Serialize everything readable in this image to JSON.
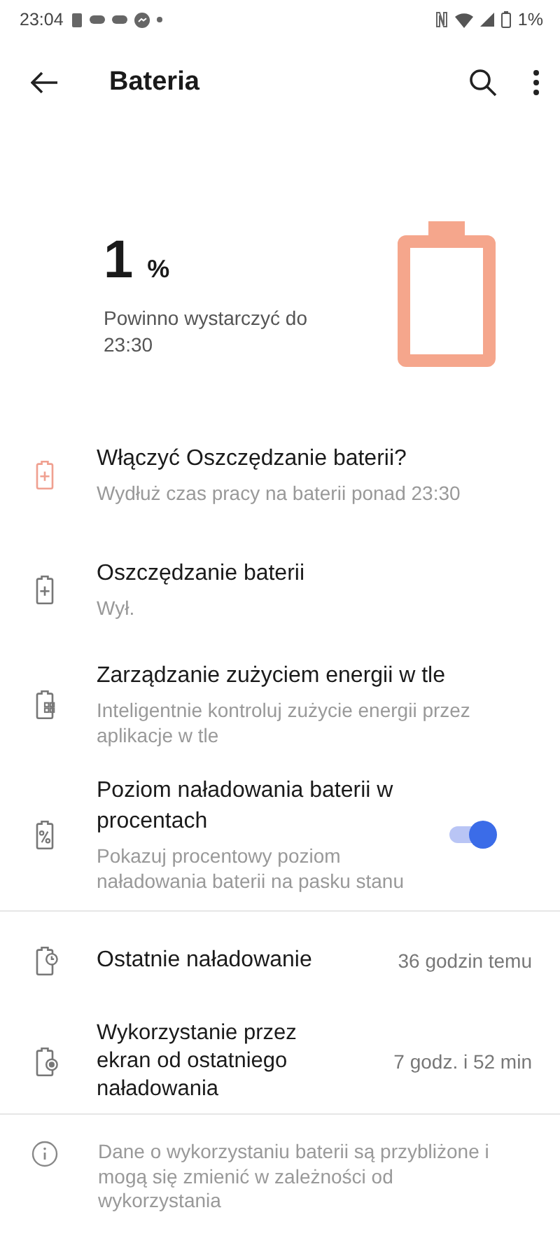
{
  "status_bar": {
    "time": "23:04",
    "battery": "1%"
  },
  "toolbar": {
    "title": "Bateria"
  },
  "summary": {
    "percent": "1",
    "unit": "%",
    "estimate": "Powinno wystarczyć do 23:30"
  },
  "items": [
    {
      "kind": "saver-alert",
      "title": "Włączyć Oszczędzanie baterii?",
      "subtitle": "Wydłuż czas pracy na baterii ponad 23:30"
    },
    {
      "kind": "saver",
      "title": "Oszczędzanie baterii",
      "subtitle": "Wył."
    },
    {
      "kind": "apps",
      "title": "Zarządzanie zużyciem energii w tle",
      "subtitle": "Inteligentnie kontroluj zużycie energii przez aplikacje w tle"
    },
    {
      "kind": "percent",
      "title": "Poziom naładowania baterii w procentach",
      "subtitle": "Pokazuj procentowy poziom naładowania baterii na pasku stanu",
      "on": true
    }
  ],
  "stats": [
    {
      "kind": "clock",
      "title": "Ostatnie naładowanie",
      "value": "36 godzin temu"
    },
    {
      "kind": "screen",
      "title": "Wykorzystanie przez ekran od ostatniego naładowania",
      "value": "7 godz. i 52 min"
    }
  ],
  "note": "Dane o wykorzystaniu baterii są przybliżone i mogą się zmienić w zależności od wykorzystania"
}
